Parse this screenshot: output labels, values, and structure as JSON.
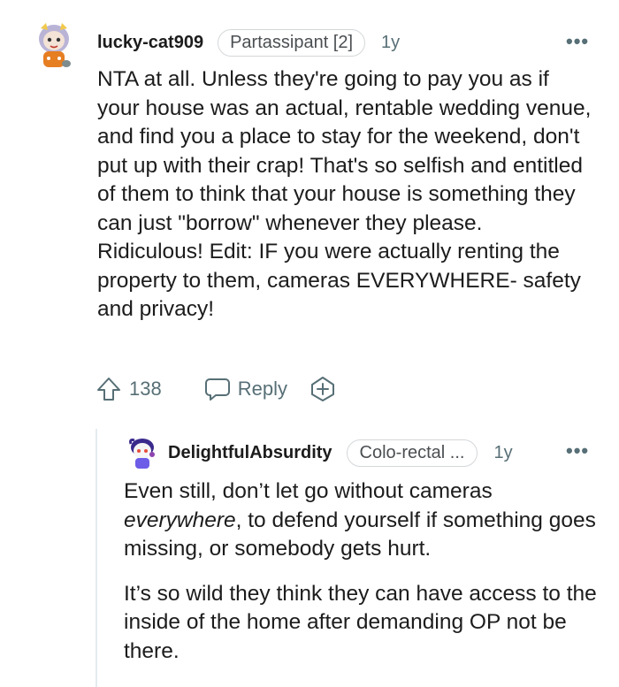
{
  "comment": {
    "username": "lucky-cat909",
    "flair": "Partassipant [2]",
    "age": "1y",
    "more_label": "•••",
    "body": "NTA at all. Unless they're going to pay you as if your house was an actual, rentable wedding venue, and find you a place to stay for the weekend, don't put up with their crap! That's so selfish and entitled of them to think that your house is something they can just \"borrow\" whenever they please. Ridiculous! Edit: IF you were actually renting the property to them, cameras EVERYWHERE- safety and privacy!",
    "vote_count": "138",
    "reply_label": "Reply",
    "icons": {
      "avatar": "cat-avatar",
      "upvote": "upvote-arrow-icon",
      "reply": "speech-bubble-icon",
      "award": "award-plus-icon"
    }
  },
  "reply": {
    "username": "DelightfulAbsurdity",
    "flair": "Colo-rectal ...",
    "age": "1y",
    "more_label": "•••",
    "body_p1_before": "Even still, don’t let go without cameras ",
    "body_p1_emphasis": "everywhere",
    "body_p1_after": ", to defend yourself if something goes missing, or somebody gets hurt.",
    "body_p2": "It’s so wild they think they can have access to the inside of the home after demanding OP not be there."
  },
  "colors": {
    "text": "#1c1c1c",
    "muted": "#576f76",
    "flair_border": "#d4d7d9",
    "thread_line": "#e5ebee"
  }
}
